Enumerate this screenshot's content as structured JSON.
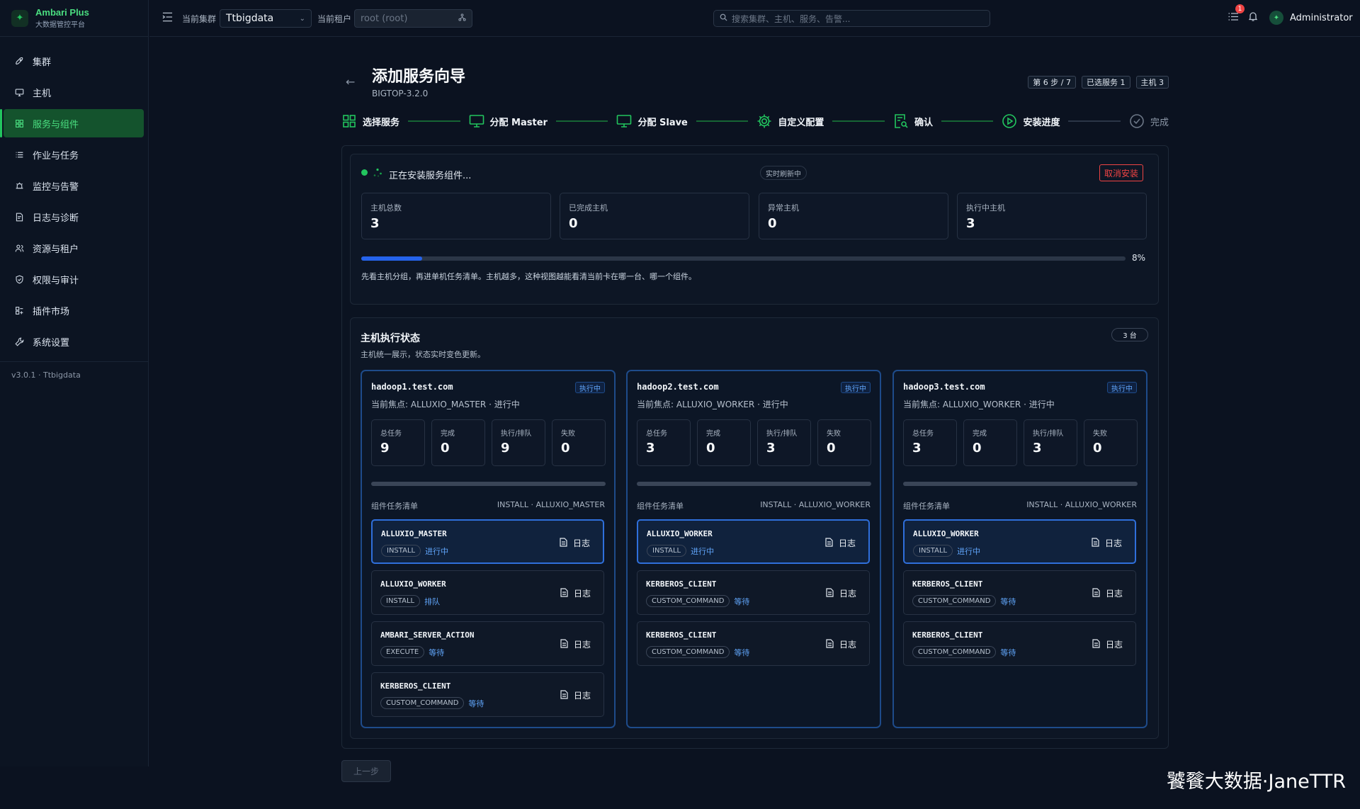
{
  "brand": {
    "name": "Ambari Plus",
    "subtitle": "大数据管控平台"
  },
  "sidebar": {
    "items": [
      {
        "label": "集群",
        "icon": "rocket-icon"
      },
      {
        "label": "主机",
        "icon": "monitor-icon"
      },
      {
        "label": "服务与组件",
        "icon": "grid-icon",
        "active": true
      },
      {
        "label": "作业与任务",
        "icon": "list-icon"
      },
      {
        "label": "监控与告警",
        "icon": "alarm-icon"
      },
      {
        "label": "日志与诊断",
        "icon": "log-icon"
      },
      {
        "label": "资源与租户",
        "icon": "users-icon"
      },
      {
        "label": "权限与审计",
        "icon": "shield-icon"
      },
      {
        "label": "插件市场",
        "icon": "plugin-icon"
      },
      {
        "label": "系统设置",
        "icon": "wrench-icon"
      }
    ],
    "version": "v3.0.1 · Ttbigdata"
  },
  "topbar": {
    "cluster_label": "当前集群",
    "cluster_value": "Ttbigdata",
    "tenant_label": "当前租户",
    "tenant_value": "root (root)",
    "search_placeholder": "搜索集群、主机、服务、告警...",
    "notif_count": "1",
    "user": "Administrator"
  },
  "wizard": {
    "title": "添加服务向导",
    "version": "BIGTOP-3.2.0",
    "badges": [
      "第 6 步 / 7",
      "已选服务 1",
      "主机 3"
    ],
    "steps": [
      {
        "label": "选择服务",
        "icon": "grid-icon",
        "done": true
      },
      {
        "label": "分配 Master",
        "icon": "monitor-icon",
        "done": true
      },
      {
        "label": "分配 Slave",
        "icon": "monitor-icon",
        "done": true
      },
      {
        "label": "自定义配置",
        "icon": "gear-icon",
        "done": true
      },
      {
        "label": "确认",
        "icon": "doc-search-icon",
        "done": true
      },
      {
        "label": "安装进度",
        "icon": "play-icon",
        "done": true
      },
      {
        "label": "完成",
        "icon": "check-circle-icon",
        "done": false
      }
    ]
  },
  "install": {
    "status": "正在安装服务组件...",
    "live": "实时刷新中",
    "cancel": "取消安装",
    "kpis": [
      {
        "label": "主机总数",
        "value": "3"
      },
      {
        "label": "已完成主机",
        "value": "0"
      },
      {
        "label": "异常主机",
        "value": "0"
      },
      {
        "label": "执行中主机",
        "value": "3"
      }
    ],
    "progress": "8%",
    "progress_value": 0.08,
    "hint": "先看主机分组，再进单机任务清单。主机越多，这种视图越能看清当前卡在哪一台、哪一个组件。"
  },
  "hosts_section": {
    "title": "主机执行状态",
    "subtitle": "主机统一展示，状态实时变色更新。",
    "count": "3 台",
    "metric_labels": [
      "总任务",
      "完成",
      "执行/排队",
      "失败"
    ],
    "list_label": "组件任务清单",
    "log_label": "日志",
    "hosts": [
      {
        "name": "hadoop1.test.com",
        "status": "执行中",
        "focus": "当前焦点:  ALLUXIO_MASTER · 进行中",
        "metrics": [
          "9",
          "0",
          "9",
          "0"
        ],
        "list_right": "INSTALL · ALLUXIO_MASTER",
        "tasks": [
          {
            "name": "ALLUXIO_MASTER",
            "type": "INSTALL",
            "state": "进行中",
            "current": true
          },
          {
            "name": "ALLUXIO_WORKER",
            "type": "INSTALL",
            "state": "排队"
          },
          {
            "name": "AMBARI_SERVER_ACTION",
            "type": "EXECUTE",
            "state": "等待"
          },
          {
            "name": "KERBEROS_CLIENT",
            "type": "CUSTOM_COMMAND",
            "state": "等待"
          }
        ]
      },
      {
        "name": "hadoop2.test.com",
        "status": "执行中",
        "focus": "当前焦点:  ALLUXIO_WORKER · 进行中",
        "metrics": [
          "3",
          "0",
          "3",
          "0"
        ],
        "list_right": "INSTALL · ALLUXIO_WORKER",
        "tasks": [
          {
            "name": "ALLUXIO_WORKER",
            "type": "INSTALL",
            "state": "进行中",
            "current": true
          },
          {
            "name": "KERBEROS_CLIENT",
            "type": "CUSTOM_COMMAND",
            "state": "等待"
          },
          {
            "name": "KERBEROS_CLIENT",
            "type": "CUSTOM_COMMAND",
            "state": "等待"
          }
        ]
      },
      {
        "name": "hadoop3.test.com",
        "status": "执行中",
        "focus": "当前焦点:  ALLUXIO_WORKER · 进行中",
        "metrics": [
          "3",
          "0",
          "3",
          "0"
        ],
        "list_right": "INSTALL · ALLUXIO_WORKER",
        "tasks": [
          {
            "name": "ALLUXIO_WORKER",
            "type": "INSTALL",
            "state": "进行中",
            "current": true
          },
          {
            "name": "KERBEROS_CLIENT",
            "type": "CUSTOM_COMMAND",
            "state": "等待"
          },
          {
            "name": "KERBEROS_CLIENT",
            "type": "CUSTOM_COMMAND",
            "state": "等待"
          }
        ]
      }
    ]
  },
  "footer": {
    "prev": "上一步",
    "watermark": "饕餮大数据·JaneTTR"
  },
  "colors": {
    "accent": "#22c55e",
    "info": "#60a5fa",
    "danger": "#ef4444",
    "bg": "#0b1220"
  }
}
